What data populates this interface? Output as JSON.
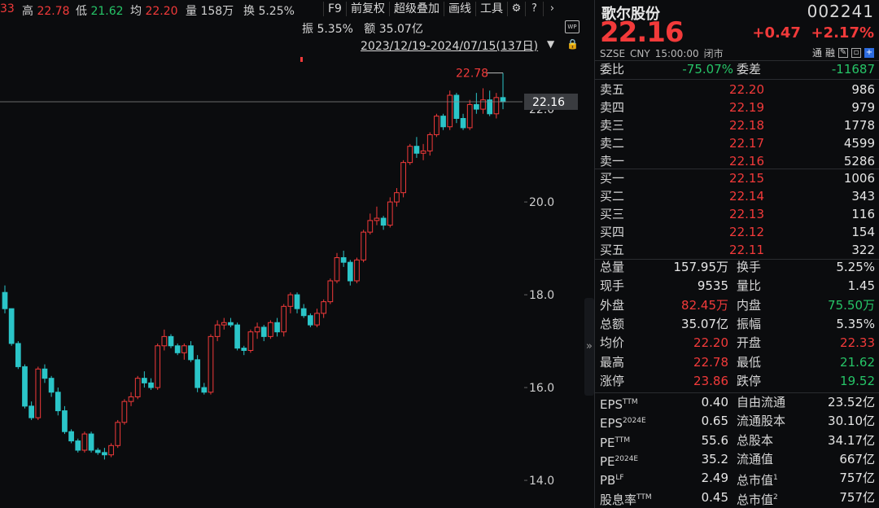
{
  "topbar": {
    "prev_fragment": "33",
    "high_label": "高",
    "high": "22.78",
    "low_label": "低",
    "low": "21.62",
    "avg_label": "均",
    "avg": "22.20",
    "vol_label": "量",
    "vol": "158万",
    "turnover_label": "换",
    "turnover": "5.25%",
    "amp_label": "振",
    "amp": "5.35%",
    "amount_label": "额",
    "amount": "35.07亿"
  },
  "toolbar": {
    "f9": "F9",
    "restore": "前复权",
    "overlay": "超级叠加",
    "draw": "画线",
    "tools": "工具",
    "settings_icon": "⚙",
    "help_icon": "?",
    "more_icon": "›"
  },
  "range": "2023/12/19-2024/07/15(137日)",
  "wp_badge": "WP",
  "collapse_glyph": "»",
  "chart_data": {
    "type": "candlestick",
    "count": 137,
    "y_ticks": [
      "22.0",
      "20.0",
      "18.0",
      "16.0",
      "14.0"
    ],
    "y_tick_values": [
      22.0,
      20.0,
      18.0,
      16.0,
      14.0
    ],
    "ylim": [
      13.65,
      23.3
    ],
    "last_price_label": "22.16",
    "last_price": 22.16,
    "max_label": "22.78",
    "max_value": 22.78,
    "colors": {
      "up": "#f23a3a",
      "down": "#2bc5c8"
    },
    "candles": [
      [
        18.05,
        18.2,
        17.6,
        17.7
      ],
      [
        17.7,
        17.7,
        16.9,
        16.95
      ],
      [
        16.95,
        17.0,
        16.4,
        16.45
      ],
      [
        16.45,
        16.5,
        15.55,
        15.6
      ],
      [
        15.6,
        15.7,
        15.3,
        15.35
      ],
      [
        15.35,
        16.45,
        15.3,
        16.4
      ],
      [
        16.4,
        16.5,
        16.1,
        16.2
      ],
      [
        16.2,
        16.25,
        15.8,
        15.9
      ],
      [
        15.9,
        16.0,
        15.4,
        15.5
      ],
      [
        15.5,
        15.6,
        15.0,
        15.05
      ],
      [
        15.05,
        15.1,
        14.8,
        14.85
      ],
      [
        14.85,
        14.9,
        14.6,
        14.65
      ],
      [
        14.65,
        15.05,
        14.6,
        15.0
      ],
      [
        15.0,
        15.05,
        14.6,
        14.65
      ],
      [
        14.65,
        14.7,
        14.55,
        14.6
      ],
      [
        14.6,
        14.7,
        14.45,
        14.55
      ],
      [
        14.55,
        14.8,
        14.5,
        14.75
      ],
      [
        14.75,
        15.3,
        14.7,
        15.25
      ],
      [
        15.25,
        15.75,
        15.2,
        15.7
      ],
      [
        15.7,
        15.9,
        15.6,
        15.8
      ],
      [
        15.8,
        16.25,
        15.75,
        16.2
      ],
      [
        16.2,
        16.35,
        16.0,
        16.1
      ],
      [
        16.1,
        16.2,
        15.95,
        16.0
      ],
      [
        16.0,
        16.95,
        15.95,
        16.9
      ],
      [
        16.9,
        17.25,
        16.8,
        17.1
      ],
      [
        17.1,
        17.15,
        16.85,
        16.9
      ],
      [
        16.9,
        16.95,
        16.7,
        16.75
      ],
      [
        16.75,
        16.95,
        16.6,
        16.9
      ],
      [
        16.9,
        17.0,
        16.55,
        16.6
      ],
      [
        16.6,
        16.7,
        15.9,
        16.0
      ],
      [
        16.0,
        16.1,
        15.85,
        15.9
      ],
      [
        15.9,
        17.15,
        15.85,
        17.1
      ],
      [
        17.1,
        17.45,
        17.0,
        17.35
      ],
      [
        17.35,
        17.5,
        17.25,
        17.4
      ],
      [
        17.4,
        17.5,
        17.3,
        17.35
      ],
      [
        17.35,
        17.4,
        16.8,
        16.85
      ],
      [
        16.85,
        16.9,
        16.7,
        16.8
      ],
      [
        16.8,
        17.25,
        16.75,
        17.2
      ],
      [
        17.2,
        17.4,
        17.05,
        17.3
      ],
      [
        17.3,
        17.35,
        17.0,
        17.1
      ],
      [
        17.1,
        17.45,
        17.05,
        17.4
      ],
      [
        17.4,
        17.5,
        17.1,
        17.2
      ],
      [
        17.2,
        17.8,
        17.1,
        17.75
      ],
      [
        17.75,
        18.05,
        17.6,
        18.0
      ],
      [
        18.0,
        18.05,
        17.6,
        17.7
      ],
      [
        17.7,
        17.8,
        17.5,
        17.55
      ],
      [
        17.55,
        17.6,
        17.3,
        17.35
      ],
      [
        17.35,
        17.7,
        17.3,
        17.6
      ],
      [
        17.6,
        17.9,
        17.5,
        17.85
      ],
      [
        17.85,
        18.35,
        17.8,
        18.3
      ],
      [
        18.3,
        18.9,
        18.25,
        18.8
      ],
      [
        18.8,
        18.95,
        18.6,
        18.7
      ],
      [
        18.7,
        18.75,
        18.2,
        18.3
      ],
      [
        18.3,
        18.8,
        18.25,
        18.75
      ],
      [
        18.75,
        19.4,
        18.7,
        19.35
      ],
      [
        19.35,
        19.75,
        19.3,
        19.6
      ],
      [
        19.6,
        19.9,
        19.5,
        19.65
      ],
      [
        19.65,
        19.7,
        19.4,
        19.5
      ],
      [
        19.5,
        20.1,
        19.45,
        20.0
      ],
      [
        20.0,
        20.3,
        19.9,
        20.2
      ],
      [
        20.2,
        20.9,
        20.1,
        20.85
      ],
      [
        20.85,
        21.25,
        20.8,
        21.2
      ],
      [
        21.2,
        21.4,
        20.95,
        21.05
      ],
      [
        21.05,
        21.25,
        20.9,
        21.1
      ],
      [
        21.1,
        21.5,
        21.0,
        21.45
      ],
      [
        21.45,
        21.9,
        21.4,
        21.85
      ],
      [
        21.85,
        21.9,
        21.55,
        21.62
      ],
      [
        21.62,
        22.4,
        21.55,
        22.3
      ],
      [
        22.3,
        22.35,
        21.7,
        21.8
      ],
      [
        21.8,
        21.9,
        21.55,
        21.6
      ],
      [
        21.6,
        22.2,
        21.55,
        22.1
      ],
      [
        22.1,
        22.35,
        21.9,
        22.0
      ],
      [
        22.0,
        22.45,
        21.9,
        22.2
      ],
      [
        22.2,
        22.4,
        21.85,
        21.9
      ],
      [
        21.9,
        22.35,
        21.8,
        22.25
      ],
      [
        22.25,
        22.78,
        22.0,
        22.16
      ]
    ],
    "note_candles": "representative OHLC sample of visible bars"
  },
  "panel": {
    "name": "歌尔股份",
    "code": "002241",
    "price": "22.16",
    "change": "+0.47",
    "change_pct": "+2.17%",
    "market": "SZSE",
    "currency": "CNY",
    "time": "15:00:00",
    "status": "闭市",
    "tool_tong": "通",
    "tool_rong": "融",
    "weibi_label": "委比",
    "weibi": "-75.07%",
    "weicha_label": "委差",
    "weicha": "-11687",
    "asks": [
      {
        "label": "卖五",
        "price": "22.20",
        "vol": "986"
      },
      {
        "label": "卖四",
        "price": "22.19",
        "vol": "979"
      },
      {
        "label": "卖三",
        "price": "22.18",
        "vol": "1778"
      },
      {
        "label": "卖二",
        "price": "22.17",
        "vol": "4599"
      },
      {
        "label": "卖一",
        "price": "22.16",
        "vol": "5286"
      }
    ],
    "bids": [
      {
        "label": "买一",
        "price": "22.15",
        "vol": "1006"
      },
      {
        "label": "买二",
        "price": "22.14",
        "vol": "343"
      },
      {
        "label": "买三",
        "price": "22.13",
        "vol": "116"
      },
      {
        "label": "买四",
        "price": "22.12",
        "vol": "154"
      },
      {
        "label": "买五",
        "price": "22.11",
        "vol": "322"
      }
    ],
    "stats": [
      {
        "l1": "总量",
        "v1": "157.95万",
        "c1": "wh",
        "l2": "换手",
        "v2": "5.25%",
        "c2": "wh"
      },
      {
        "l1": "现手",
        "v1": "9535",
        "c1": "wh",
        "l2": "量比",
        "v2": "1.45",
        "c2": "wh"
      },
      {
        "l1": "外盘",
        "v1": "82.45万",
        "c1": "up",
        "l2": "内盘",
        "v2": "75.50万",
        "c2": "dn"
      },
      {
        "l1": "总额",
        "v1": "35.07亿",
        "c1": "wh",
        "l2": "振幅",
        "v2": "5.35%",
        "c2": "wh"
      },
      {
        "l1": "均价",
        "v1": "22.20",
        "c1": "up",
        "l2": "开盘",
        "v2": "22.33",
        "c2": "up"
      },
      {
        "l1": "最高",
        "v1": "22.78",
        "c1": "up",
        "l2": "最低",
        "v2": "21.62",
        "c2": "dn"
      },
      {
        "l1": "涨停",
        "v1": "23.86",
        "c1": "up",
        "l2": "跌停",
        "v2": "19.52",
        "c2": "dn"
      }
    ],
    "fund": [
      {
        "l1": "EPS",
        "s1": "TTM",
        "v1": "0.40",
        "l2": "自由流通",
        "s2": "",
        "v2": "23.52亿"
      },
      {
        "l1": "EPS",
        "s1": "2024E",
        "v1": "0.65",
        "l2": "流通股本",
        "s2": "",
        "v2": "30.10亿"
      },
      {
        "l1": "PE",
        "s1": "TTM",
        "v1": "55.6",
        "l2": "总股本",
        "s2": "",
        "v2": "34.17亿"
      },
      {
        "l1": "PE",
        "s1": "2024E",
        "v1": "35.2",
        "l2": "流通值",
        "s2": "",
        "v2": "667亿"
      },
      {
        "l1": "PB",
        "s1": "LF",
        "v1": "2.49",
        "l2": "总市值",
        "s2": "1",
        "v2": "757亿"
      },
      {
        "l1": "股息率",
        "s1": "TTM",
        "v1": "0.45",
        "l2": "总市值",
        "s2": "2",
        "v2": "757亿"
      }
    ]
  }
}
